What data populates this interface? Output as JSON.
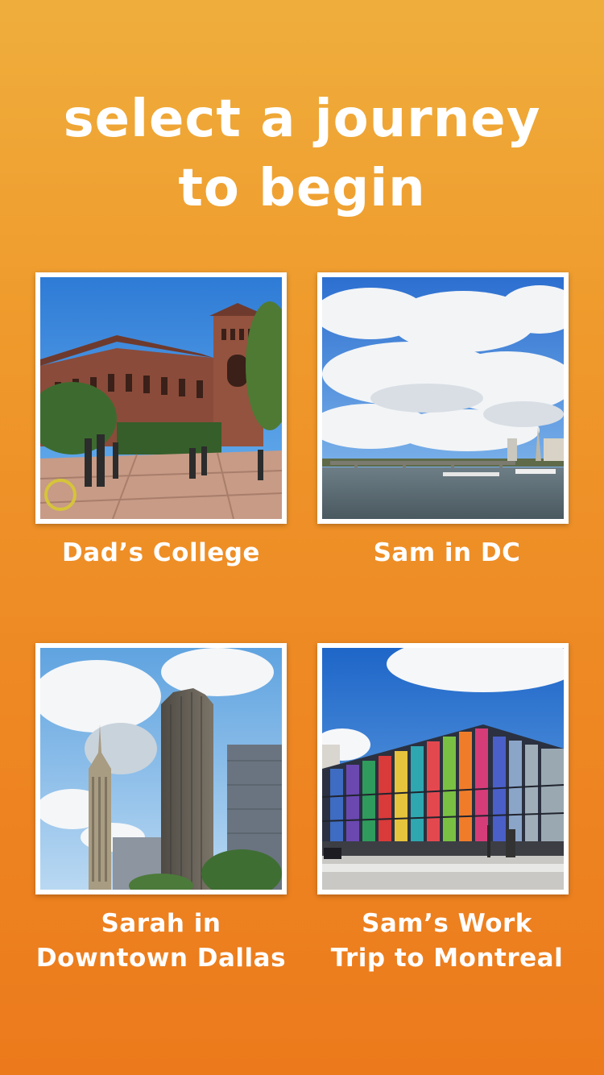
{
  "header": {
    "title_line1": "select a journey",
    "title_line2": "to begin"
  },
  "journeys": [
    {
      "label_lines": [
        "Dad’s College"
      ],
      "image": "college-campus-photo"
    },
    {
      "label_lines": [
        "Sam in DC"
      ],
      "image": "river-clouds-photo"
    },
    {
      "label_lines": [
        "Sarah in",
        "Downtown Dallas"
      ],
      "image": "dallas-skyscrapers-photo"
    },
    {
      "label_lines": [
        "Sam’s Work",
        "Trip to Montreal"
      ],
      "image": "montreal-colorful-building-photo"
    }
  ],
  "colors": {
    "background_top": "#EFAE3C",
    "background_bottom": "#EC7A1C",
    "text": "#FFFFFF",
    "card_border": "#FFFFFF"
  }
}
